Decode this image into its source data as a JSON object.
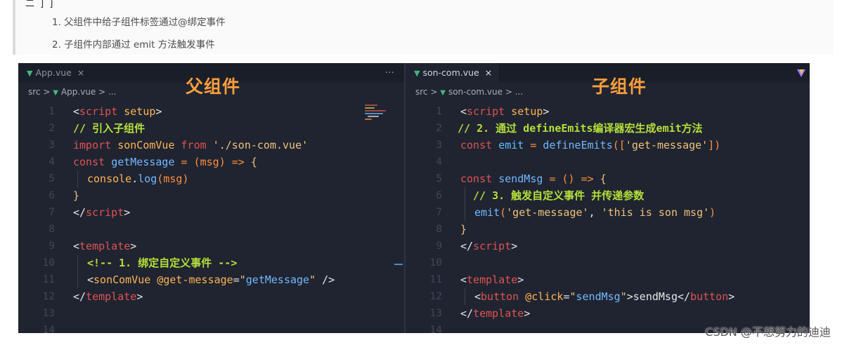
{
  "top_cut": "二 ] ]",
  "steps": [
    "1. 父组件中给子组件标签通过@绑定事件",
    "2. 子组件内部通过 emit 方法触发事件"
  ],
  "left": {
    "tab": "App.vue",
    "tab_close": "×",
    "more": "···",
    "crumbs": {
      "root": "src",
      "sep": ">",
      "file": "App.vue",
      "more": "..."
    },
    "title": "父组件",
    "lines": [
      "1",
      "2",
      "3",
      "4",
      "5",
      "6",
      "7",
      "8",
      "9",
      "10",
      "11",
      "12",
      "13",
      "14"
    ]
  },
  "right": {
    "tab": "son-com.vue",
    "tab_close": "×",
    "crumbs": {
      "root": "src",
      "sep": ">",
      "file": "son-com.vue",
      "more": "..."
    },
    "title": "子组件",
    "lines": [
      "1",
      "2",
      "3",
      "4",
      "5",
      "6",
      "7",
      "8",
      "9",
      "10",
      "11",
      "12",
      "13",
      "14"
    ]
  },
  "code_left": {
    "l1_tag_open": "<",
    "l1_tag": "script",
    "l1_attr": "setup",
    "l1_close": ">",
    "l2": "// 引入子组件",
    "l3_kw": "import",
    "l3_id": "sonComVue",
    "l3_from": "from",
    "l3_str": "'./son-com.vue'",
    "l4_kw": "const",
    "l4_fn": "getMessage",
    "l4_eq": "=",
    "l4_p1": "(",
    "l4_param": "msg",
    "l4_p2": ")",
    "l4_arrow": "=>",
    "l4_brace": "{",
    "l5_obj": "console",
    "l5_dot": ".",
    "l5_fn": "log",
    "l5_p1": "(",
    "l5_param": "msg",
    "l5_p2": ")",
    "l6": "}",
    "l7_open": "</",
    "l7_tag": "script",
    "l7_close": ">",
    "l9_open": "<",
    "l9_tag": "template",
    "l9_close": ">",
    "l10": "<!-- 1. 绑定自定义事件 -->",
    "l11_open": "<",
    "l11_tag": "sonComVue",
    "l11_attr": "@get-message",
    "l11_eq": "=",
    "l11_q1": "\"",
    "l11_val": "getMessage",
    "l11_q2": "\"",
    "l11_end": " />",
    "l12_open": "</",
    "l12_tag": "template",
    "l12_close": ">"
  },
  "code_right": {
    "l1_open": "<",
    "l1_tag": "script",
    "l1_attr": "setup",
    "l1_close": ">",
    "l2": "// 2. 通过 defineEmits编译器宏生成emit方法",
    "l3_kw": "const",
    "l3_id": "emit",
    "l3_eq": "=",
    "l3_fn": "defineEmits",
    "l3_p1": "([",
    "l3_str": "'get-message'",
    "l3_p2": "])",
    "l5_kw": "const",
    "l5_fn": "sendMsg",
    "l5_eq": "=",
    "l5_parens": "()",
    "l5_arrow": "=>",
    "l5_brace": "{",
    "l6": "// 3. 触发自定义事件 并传递参数",
    "l7_fn": "emit",
    "l7_p1": "(",
    "l7_s1": "'get-message'",
    "l7_comma": ", ",
    "l7_s2": "'this is son msg'",
    "l7_p2": ")",
    "l8": "}",
    "l9_open": "</",
    "l9_tag": "script",
    "l9_close": ">",
    "l11_open": "<",
    "l11_tag": "template",
    "l11_close": ">",
    "l12_open": "<",
    "l12_tag": "button",
    "l12_attr": "@click",
    "l12_eq": "=",
    "l12_q1": "\"",
    "l12_val": "sendMsg",
    "l12_q2": "\"",
    "l12_gt": ">",
    "l12_text": "sendMsg",
    "l12_copen": "</",
    "l12_ctag": "button",
    "l12_cgt": ">",
    "l13_open": "</",
    "l13_tag": "template",
    "l13_close": ">"
  },
  "watermark": "CSDN @不想努力的迪迪",
  "colors": {
    "accent_title": "#ff9e3b",
    "editor_bg": "#1f2430",
    "vue_green": "#41b883"
  }
}
